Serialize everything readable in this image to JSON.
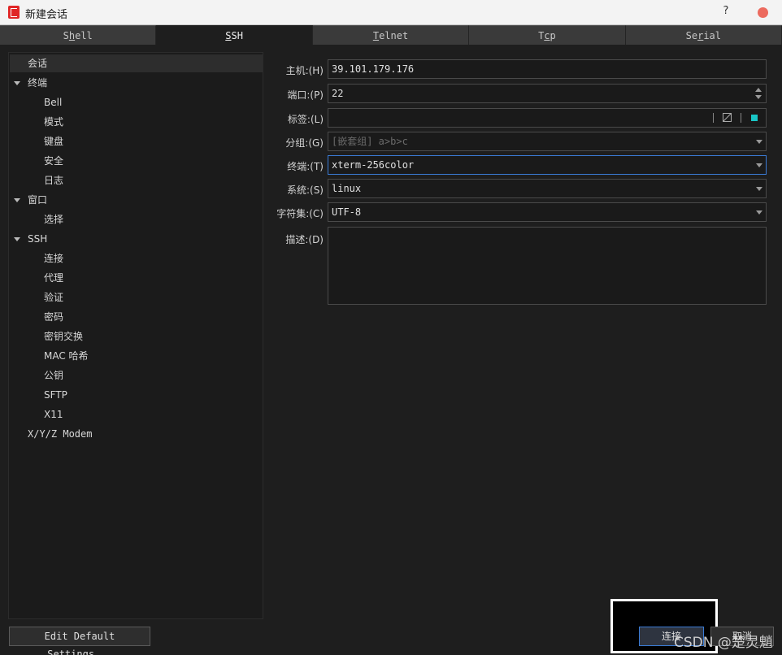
{
  "window": {
    "title": "新建会话",
    "help": "?"
  },
  "tabs": [
    {
      "label_pre": "S",
      "label_u": "h",
      "label_post": "ell"
    },
    {
      "label_pre": "",
      "label_u": "S",
      "label_post": "SH"
    },
    {
      "label_pre": "",
      "label_u": "T",
      "label_post": "elnet"
    },
    {
      "label_pre": "T",
      "label_u": "c",
      "label_post": "p"
    },
    {
      "label_pre": "Se",
      "label_u": "r",
      "label_post": "ial"
    }
  ],
  "tree": {
    "session": "会话",
    "terminal": "终端",
    "terminal_children": [
      "Bell",
      "模式",
      "键盘",
      "安全",
      "日志"
    ],
    "window": "窗口",
    "window_children": [
      "选择"
    ],
    "ssh": "SSH",
    "ssh_children": [
      "连接",
      "代理",
      "验证",
      "密码",
      "密钥交换",
      "MAC 哈希",
      "公钥",
      "SFTP",
      "X11"
    ],
    "modem": "X/Y/Z Modem"
  },
  "form": {
    "host_label": "主机:(H)",
    "host_value": "39.101.179.176",
    "port_label": "端口:(P)",
    "port_value": "22",
    "tag_label": "标签:(L)",
    "tag_value": "",
    "group_label": "分组:(G)",
    "group_placeholder": "[嵌套组] a>b>c",
    "terminal_label": "终端:(T)",
    "terminal_value": "xterm-256color",
    "system_label": "系统:(S)",
    "system_value": "linux",
    "charset_label": "字符集:(C)",
    "charset_value": "UTF-8",
    "desc_label": "描述:(D)"
  },
  "buttons": {
    "edit_default": "Edit Default Settings...",
    "connect": "连接",
    "cancel": "取消"
  },
  "watermark": "CSDN @楚灵魈",
  "colors": {
    "accent": "#3a7bd5",
    "tag_color": "#19c6c6",
    "close": "#ec6a5e",
    "logo": "#e02626"
  }
}
